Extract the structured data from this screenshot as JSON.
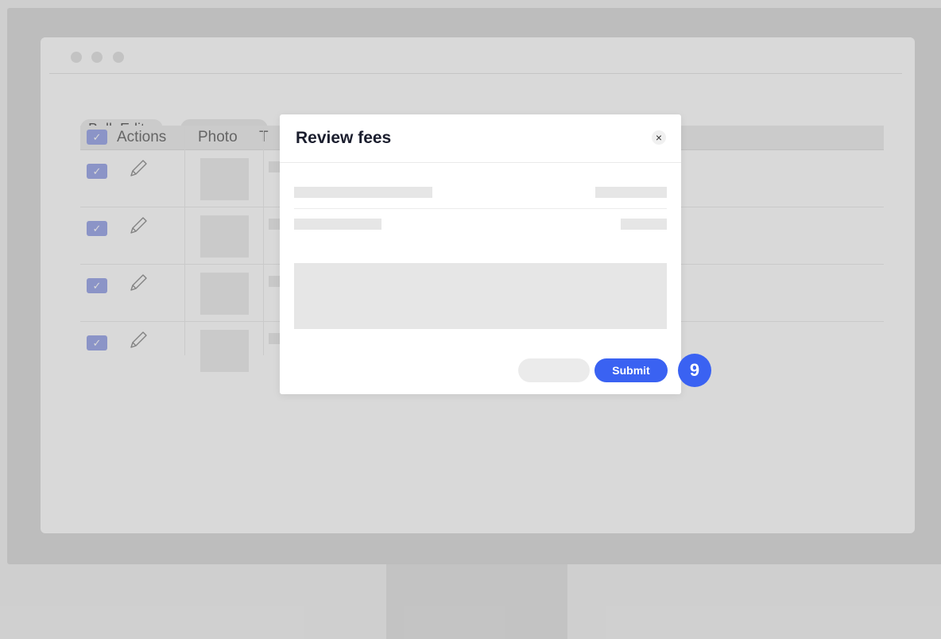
{
  "toolbar": {
    "bulk_edit_label": "Bulk Edit",
    "bulk_edit_caret": "▾"
  },
  "table": {
    "headers": {
      "actions": "Actions",
      "photo": "Photo",
      "title_partial": "T"
    },
    "rows": [
      {
        "checked": "✓"
      },
      {
        "checked": "✓"
      },
      {
        "checked": "✓"
      },
      {
        "checked": "✓"
      }
    ]
  },
  "modal": {
    "title": "Review fees",
    "close_glyph": "×",
    "submit_label": "Submit"
  },
  "step_badge": "9",
  "icons": {
    "checkbox": "check-icon",
    "edit": "pencil-icon",
    "close": "close-icon"
  },
  "colors": {
    "accent": "#3a62f2",
    "checkbox": "#a4aeea"
  }
}
